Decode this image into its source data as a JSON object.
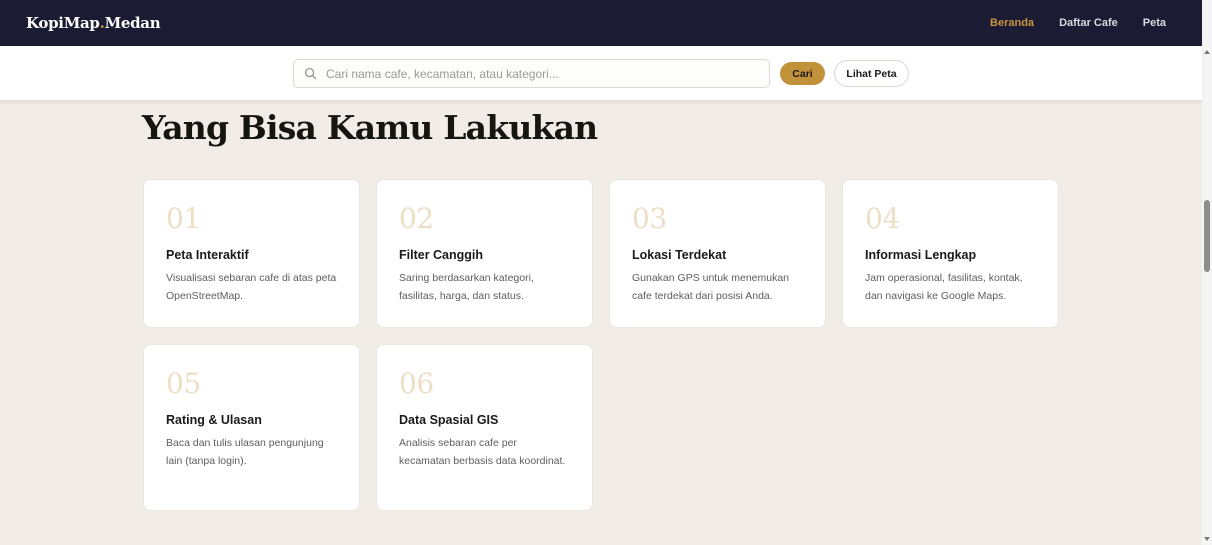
{
  "navbar": {
    "brand_main": "KopiMap",
    "brand_dot": ".",
    "brand_city": "Medan",
    "links": [
      "Beranda",
      "Daftar Cafe",
      "Peta"
    ],
    "active_link": "Beranda",
    "accent_color": "#c8943f",
    "background_color": "#1b1c33"
  },
  "search": {
    "placeholder": "Cari nama cafe, kecamatan, atau kategori...",
    "value": "",
    "submit_label": "Cari",
    "map_label": "Lihat Peta",
    "icon": "search-icon"
  },
  "section": {
    "title": "Yang Bisa Kamu Lakukan"
  },
  "features": [
    {
      "number": "01",
      "title": "Peta Interaktif",
      "description": "Visualisasi sebaran cafe di atas peta OpenStreetMap."
    },
    {
      "number": "02",
      "title": "Filter Canggih",
      "description": "Saring berdasarkan kategori, fasilitas, harga, dan status."
    },
    {
      "number": "03",
      "title": "Lokasi Terdekat",
      "description": "Gunakan GPS untuk menemukan cafe terdekat dari posisi Anda."
    },
    {
      "number": "04",
      "title": "Informasi Lengkap",
      "description": "Jam operasional, fasilitas, kontak, dan navigasi ke Google Maps."
    },
    {
      "number": "05",
      "title": "Rating & Ulasan",
      "description": "Baca dan tulis ulasan pengunjung lain (tanpa login)."
    },
    {
      "number": "06",
      "title": "Data Spasial GIS",
      "description": "Analisis sebaran cafe per kecamatan berbasis data koordinat."
    }
  ]
}
